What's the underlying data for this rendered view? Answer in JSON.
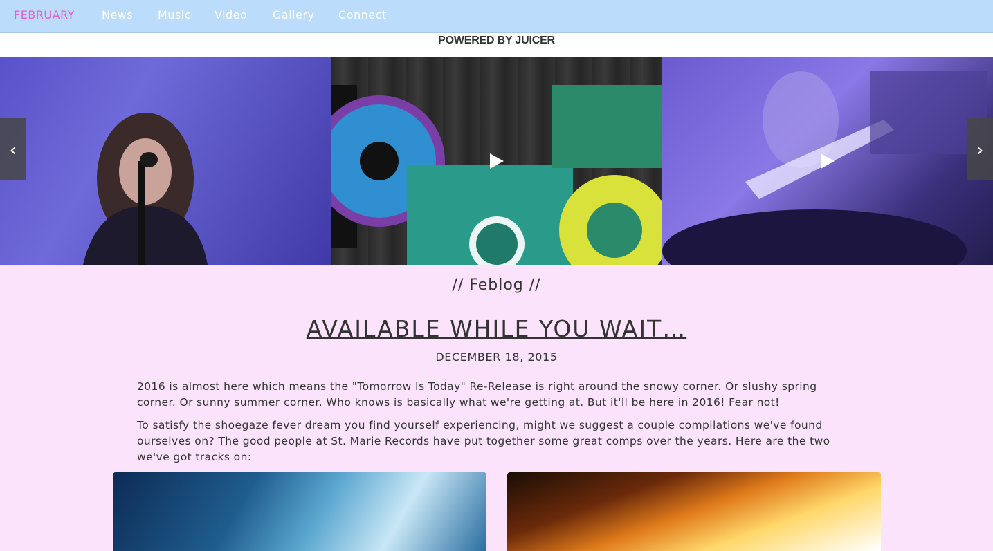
{
  "nav": {
    "brand": "FEBRUARY",
    "items": [
      {
        "label": "News"
      },
      {
        "label": "Music"
      },
      {
        "label": "Video"
      },
      {
        "label": "Gallery"
      },
      {
        "label": "Connect"
      }
    ]
  },
  "juicer": {
    "powered_by": "POWERED BY JUICER"
  },
  "carousel": {
    "prev_icon": "chevron-left-icon",
    "next_icon": "chevron-right-icon",
    "prev_glyph": "‹",
    "next_glyph": "›"
  },
  "blog": {
    "section_title": "// Feblog //",
    "post": {
      "title": "AVAILABLE WHILE YOU WAIT…",
      "date": "DECEMBER 18, 2015",
      "paragraphs": [
        "2016 is almost here which means the \"Tomorrow Is Today\" Re-Release is right around the snowy corner. Or slushy spring corner. Or sunny summer corner. Who knows is basically what we're getting at. But it'll be here in 2016! Fear not!",
        "To satisfy the shoegaze fever dream you find yourself experiencing, might we suggest a couple compilations we've found ourselves on? The good people at St. Marie Records have put together some great comps over the years. Here are the two we've got tracks on:"
      ]
    }
  },
  "colors": {
    "nav_bg": "#bcdcfb",
    "brand": "#e85ad0",
    "page_bg": "#fbe4fb"
  }
}
